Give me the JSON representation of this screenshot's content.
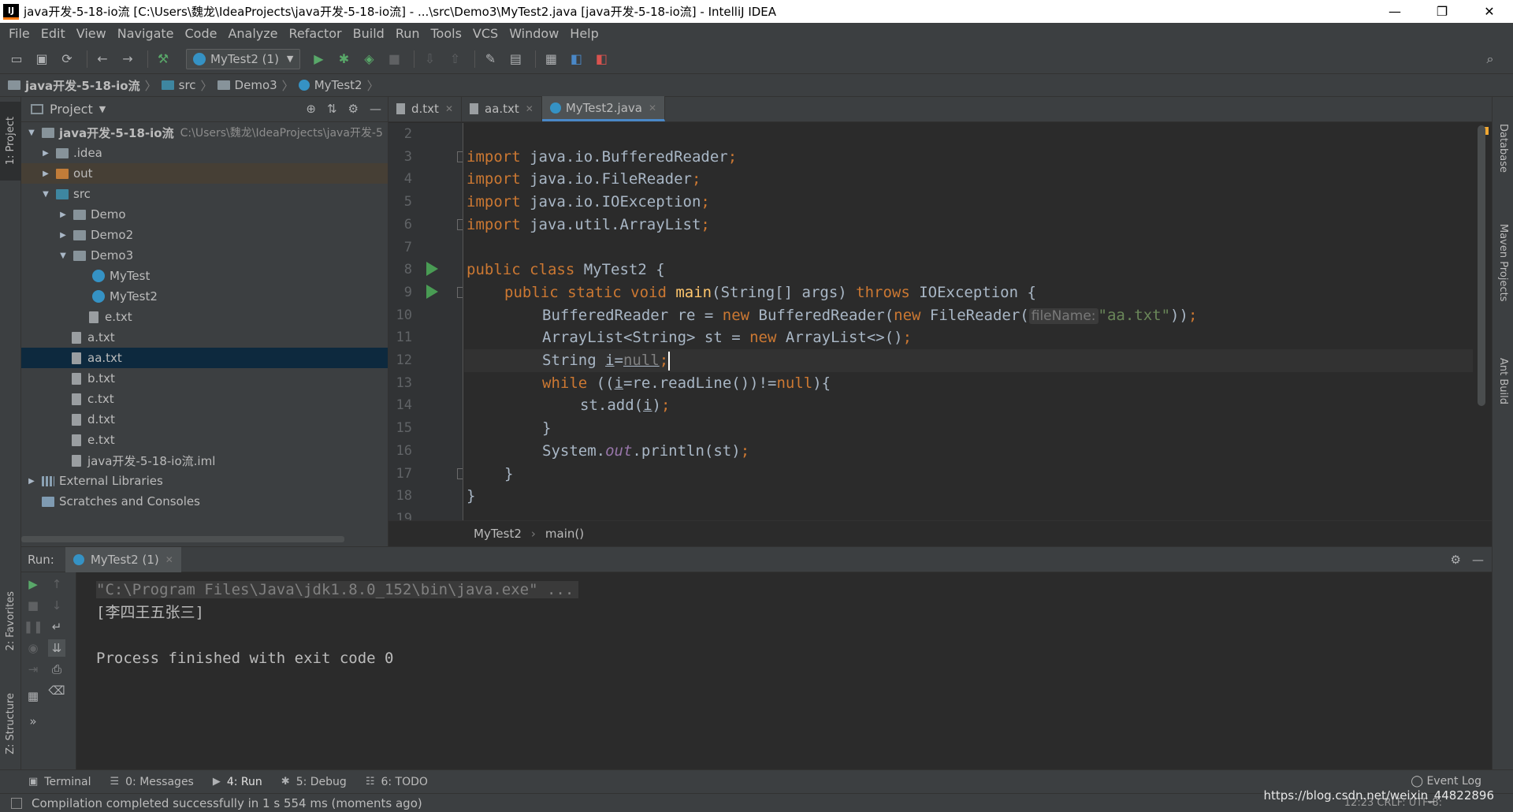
{
  "window": {
    "title": "java开发-5-18-io流 [C:\\Users\\魏龙\\IdeaProjects\\java开发-5-18-io流] - ...\\src\\Demo3\\MyTest2.java [java开发-5-18-io流] - IntelliJ IDEA",
    "app_badge": "IJ",
    "minimize": "—",
    "restore": "❐",
    "close": "✕"
  },
  "menu": [
    "File",
    "Edit",
    "View",
    "Navigate",
    "Code",
    "Analyze",
    "Refactor",
    "Build",
    "Run",
    "Tools",
    "VCS",
    "Window",
    "Help"
  ],
  "toolbar": {
    "run_config": "MyTest2 (1)",
    "icons": [
      "open-folder-icon",
      "save-icon",
      "sync-icon",
      "back-arrow-icon",
      "forward-arrow-icon",
      "build-hammer-icon",
      "run-icon",
      "debug-icon",
      "coverage-icon",
      "stop-icon",
      "vcs-update-icon",
      "vcs-commit-icon",
      "settings-wrench-icon",
      "project-structure-icon",
      "sdk-icon",
      "translate-icon",
      "translate-red-icon",
      "search-icon"
    ]
  },
  "navbar": {
    "crumbs": [
      "java开发-5-18-io流",
      "src",
      "Demo3",
      "MyTest2"
    ]
  },
  "left_strip": {
    "project_tab": "1: Project",
    "favorites_tab": "2: Favorites",
    "structure_tab": "Z: Structure"
  },
  "right_strip": {
    "database_tab": "Database",
    "maven_tab": "Maven Projects",
    "ant_tab": "Ant Build"
  },
  "project_panel": {
    "title": "Project",
    "root": {
      "label": "java开发-5-18-io流",
      "path": "C:\\Users\\魏龙\\IdeaProjects\\java开发-5"
    },
    "items": [
      {
        "label": ".idea"
      },
      {
        "label": "out"
      },
      {
        "label": "src"
      },
      {
        "label": "Demo"
      },
      {
        "label": "Demo2"
      },
      {
        "label": "Demo3"
      },
      {
        "label": "MyTest"
      },
      {
        "label": "MyTest2"
      },
      {
        "label": "e.txt"
      },
      {
        "label": "a.txt"
      },
      {
        "label": "aa.txt"
      },
      {
        "label": "b.txt"
      },
      {
        "label": "c.txt"
      },
      {
        "label": "d.txt"
      },
      {
        "label": "e.txt"
      },
      {
        "label": "java开发-5-18-io流.iml"
      },
      {
        "label": "External Libraries"
      },
      {
        "label": "Scratches and Consoles"
      }
    ]
  },
  "editor": {
    "tabs": [
      {
        "label": "d.txt",
        "active": false
      },
      {
        "label": "aa.txt",
        "active": false
      },
      {
        "label": "MyTest2.java",
        "active": true
      }
    ],
    "line_numbers": [
      "2",
      "3",
      "4",
      "5",
      "6",
      "7",
      "8",
      "9",
      "10",
      "11",
      "12",
      "13",
      "14",
      "15",
      "16",
      "17",
      "18",
      "19"
    ],
    "code": {
      "l3_kw": "import",
      "l3_rest": " java.io.BufferedReader",
      "l4_kw": "import",
      "l4_rest": " java.io.FileReader",
      "l5_kw": "import",
      "l5_rest": " java.io.IOException",
      "l6_kw": "import",
      "l6_rest": " java.util.ArrayList",
      "semi": ";",
      "l8_kw": "public class",
      "l8_rest": " MyTest2 {",
      "l9_kw1": "public static void",
      "l9_fn": "main",
      "l9_mid": "(String[] args) ",
      "l9_kw2": "throws",
      "l9_rest": " IOException {",
      "l10_a": "BufferedReader re = ",
      "l10_new1": "new",
      "l10_b": " BufferedReader(",
      "l10_new2": "new",
      "l10_c": " FileReader(",
      "l10_hint": "fileName:",
      "l10_str": "\"aa.txt\"",
      "l10_d": "))",
      "l11_a": "ArrayList<String> st = ",
      "l11_new": "new",
      "l11_b": " ArrayList<>()",
      "l12_a": "String ",
      "l12_var": "i",
      "l12_eq": "=",
      "l12_null": "null",
      "l13_kw": "while",
      "l13_a": " ((",
      "l13_var": "i",
      "l13_b": "=re.readLine())!=",
      "l13_null": "null",
      "l13_c": "){",
      "l14_a": "st.add(",
      "l14_var": "i",
      "l14_b": ")",
      "l15": "}",
      "l16_a": "System.",
      "l16_out": "out",
      "l16_b": ".println(st)",
      "l17": "}",
      "l18": "}"
    },
    "breadcrumb": [
      "MyTest2",
      "main()"
    ]
  },
  "run_panel": {
    "label": "Run:",
    "tab": "MyTest2 (1)",
    "console": {
      "cmd": "\"C:\\Program Files\\Java\\jdk1.8.0_152\\bin\\java.exe\" ...",
      "output": "[李四王五张三]",
      "finished": "Process finished with exit code 0"
    }
  },
  "bottom_tabs": [
    {
      "label": "Terminal",
      "icon": "terminal-icon"
    },
    {
      "label": "0: Messages",
      "icon": "messages-icon"
    },
    {
      "label": "4: Run",
      "icon": "run-tab-icon"
    },
    {
      "label": "5: Debug",
      "icon": "debug-tab-icon"
    },
    {
      "label": "6: TODO",
      "icon": "todo-icon"
    }
  ],
  "event_log": "Event Log",
  "status": {
    "message": "Compilation completed successfully in 1 s 554 ms (moments ago)",
    "position": "12:23  CRLF:  UTF-8:"
  },
  "watermark": "https://blog.csdn.net/weixin_44822896"
}
